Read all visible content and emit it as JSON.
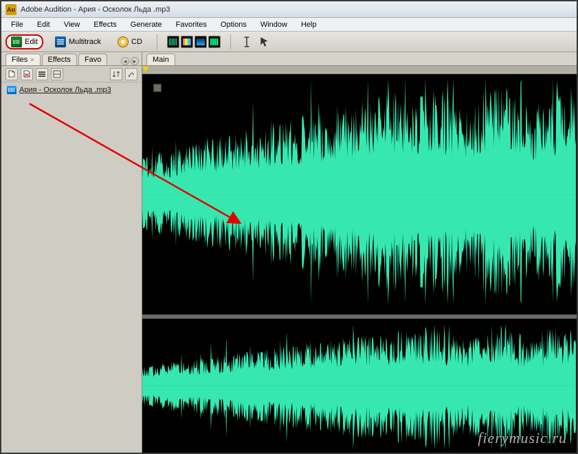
{
  "title": "Adobe Audition - Ария - Осколок Льда .mp3",
  "app_icon_text": "Au",
  "menus": [
    "File",
    "Edit",
    "View",
    "Effects",
    "Generate",
    "Favorites",
    "Options",
    "Window",
    "Help"
  ],
  "modes": {
    "edit": "Edit",
    "multitrack": "Multitrack",
    "cd": "CD"
  },
  "left_tabs": {
    "files": "Files",
    "effects": "Effects",
    "favorites": "Favo"
  },
  "main_tab": "Main",
  "file_item": "Ария - Осколок Льда .mp3",
  "watermark": "fierymusic.ru",
  "waveform": {
    "color": "#36e8b0",
    "bg": "#000000",
    "channels": 2,
    "samples_per_channel": 620,
    "seed": 20240611
  }
}
